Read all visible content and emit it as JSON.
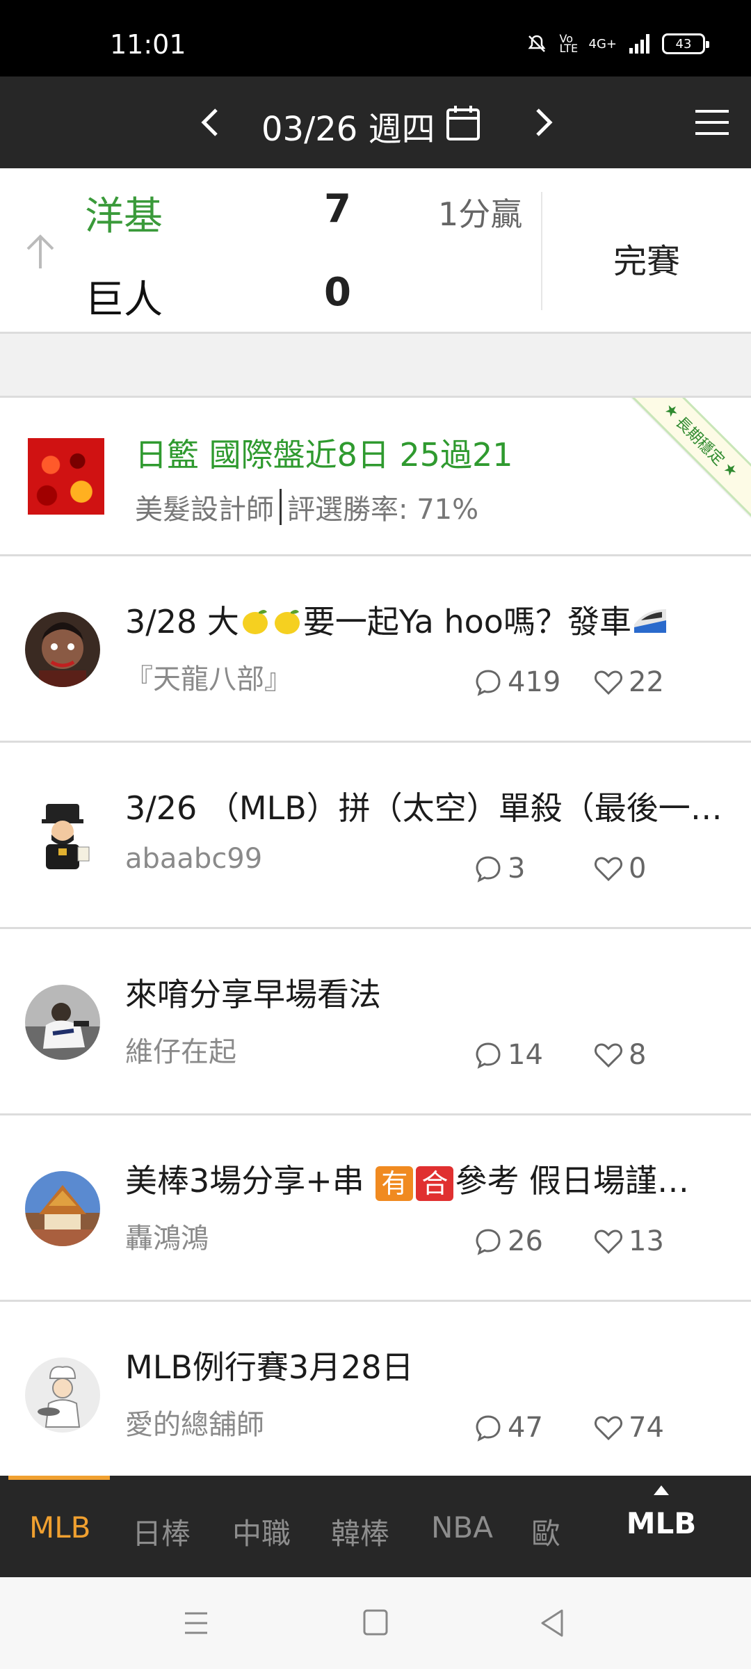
{
  "status_bar": {
    "time": "11:01",
    "network": "4G+",
    "volte": "Vo LTE",
    "battery": "43"
  },
  "header": {
    "date": "03/26 週四"
  },
  "scoreboard": {
    "away_team": "洋基",
    "away_score": "7",
    "home_team": "巨人",
    "home_score": "0",
    "result_note": "1分贏",
    "status": "完賽",
    "away_color": "#3a9a3a"
  },
  "featured": {
    "title": "日籃 國際盤近8日 25過21",
    "author": "美髮設計師",
    "win_rate": "評選勝率: 71%",
    "ribbon": "長期穩定",
    "title_color": "#2f9a2f"
  },
  "posts": [
    {
      "title_a": "3/28 大",
      "title_b": "要一起Ya hoo嗎？發車",
      "author": "『天龍八部』",
      "comments": "419",
      "likes": "22"
    },
    {
      "title": "3/26 （MLB）拼（太空）單殺（最後一…",
      "author": "abaabc99",
      "comments": "3",
      "likes": "0"
    },
    {
      "title": "來唷分享早場看法",
      "author": "維仔在起",
      "comments": "14",
      "likes": "8"
    },
    {
      "title_a": "美棒3場分享+串 ",
      "badge1": "有",
      "badge2": "合",
      "title_b": "參考 假日場謹…",
      "author": "轟鴻鴻",
      "comments": "26",
      "likes": "13"
    },
    {
      "title": "MLB例行賽3月28日",
      "author": "愛的總舖師",
      "comments": "47",
      "likes": "74"
    }
  ],
  "tabs": [
    "MLB",
    "日棒",
    "中職",
    "韓棒",
    "NBA",
    "歐"
  ],
  "league_selector": "MLB",
  "accent_color": "#f0a030"
}
